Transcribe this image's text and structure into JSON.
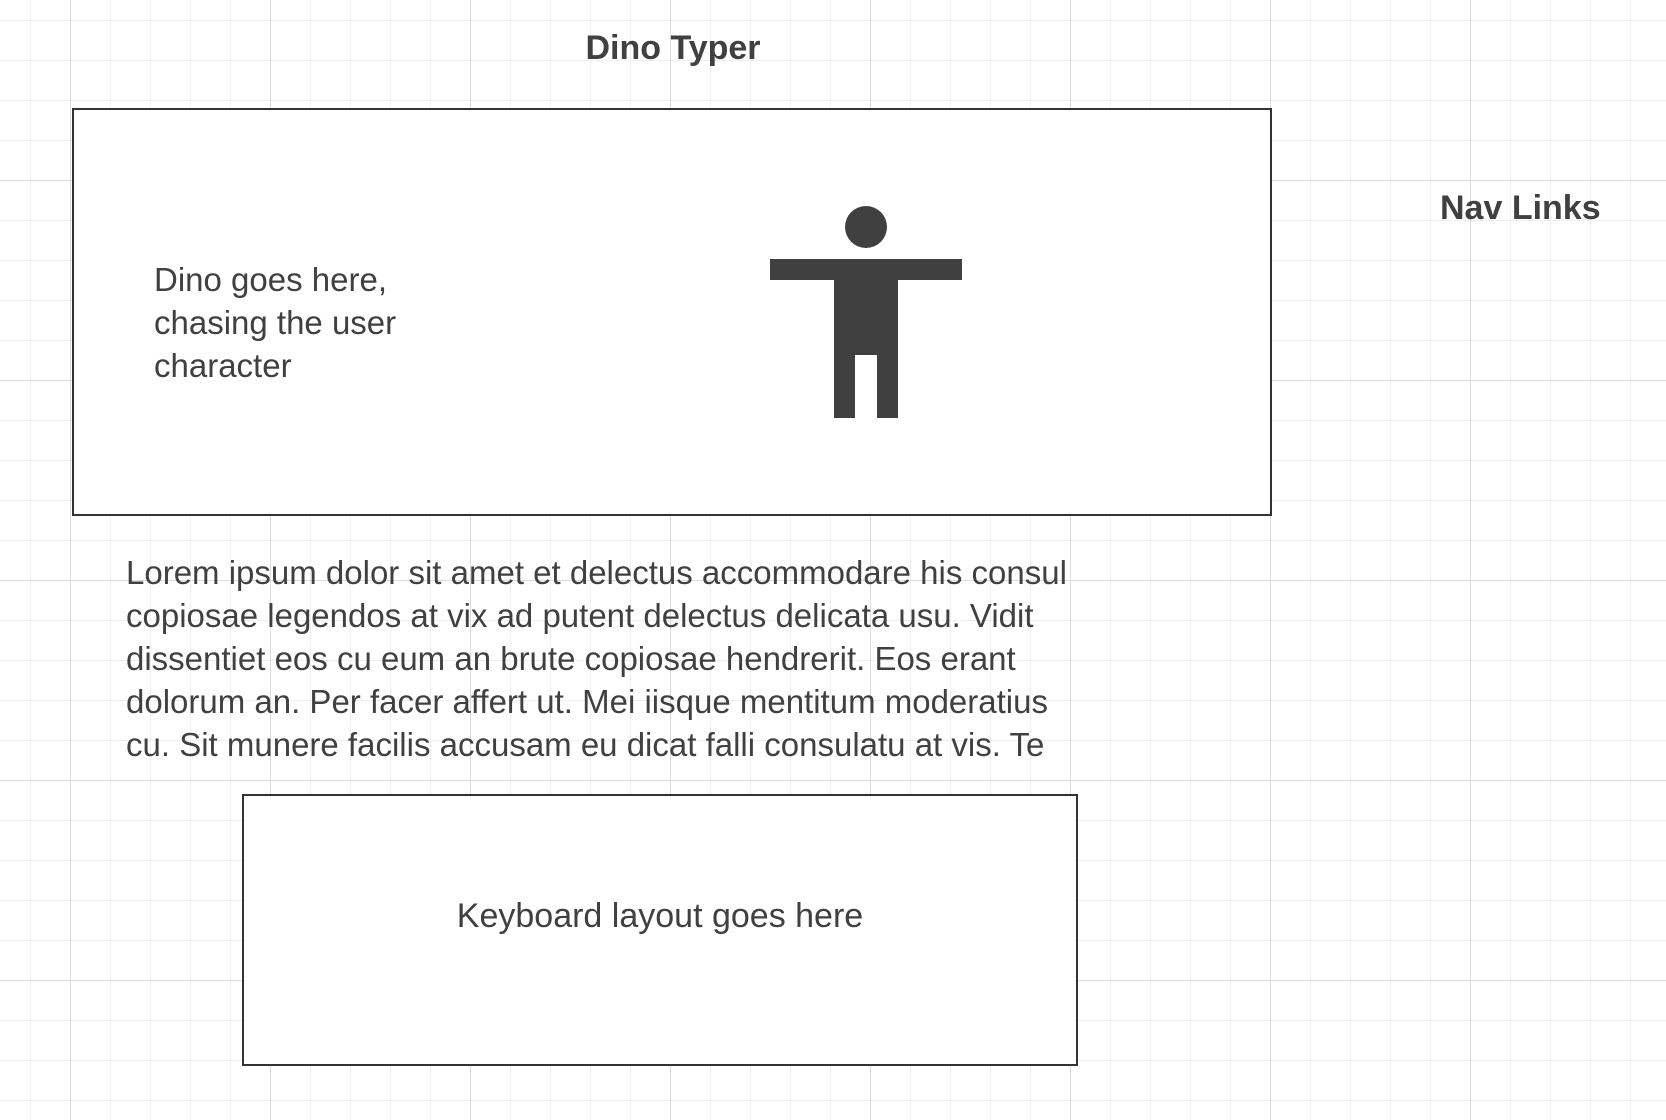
{
  "header": {
    "title": "Dino Typer",
    "nav_label": "Nav Links"
  },
  "game_area": {
    "dino_placeholder_lines": [
      "Dino goes here,",
      "chasing the user",
      "character"
    ],
    "user_icon": "accessibility-person-icon"
  },
  "typing_text": {
    "lines": [
      "Lorem ipsum dolor sit amet et delectus accommodare his consul",
      "copiosae legendos at vix ad putent delectus delicata usu. Vidit",
      "dissentiet eos cu eum an brute copiosae hendrerit. Eos erant",
      "dolorum an. Per facer affert ut. Mei iisque mentitum moderatius",
      "cu. Sit munere facilis accusam eu dicat falli consulatu at vis. Te"
    ]
  },
  "keyboard": {
    "placeholder": "Keyboard layout goes here"
  },
  "colors": {
    "text": "#404040",
    "border": "#333333",
    "grid_major": "#dcdcdc",
    "grid_minor": "#efefef"
  }
}
